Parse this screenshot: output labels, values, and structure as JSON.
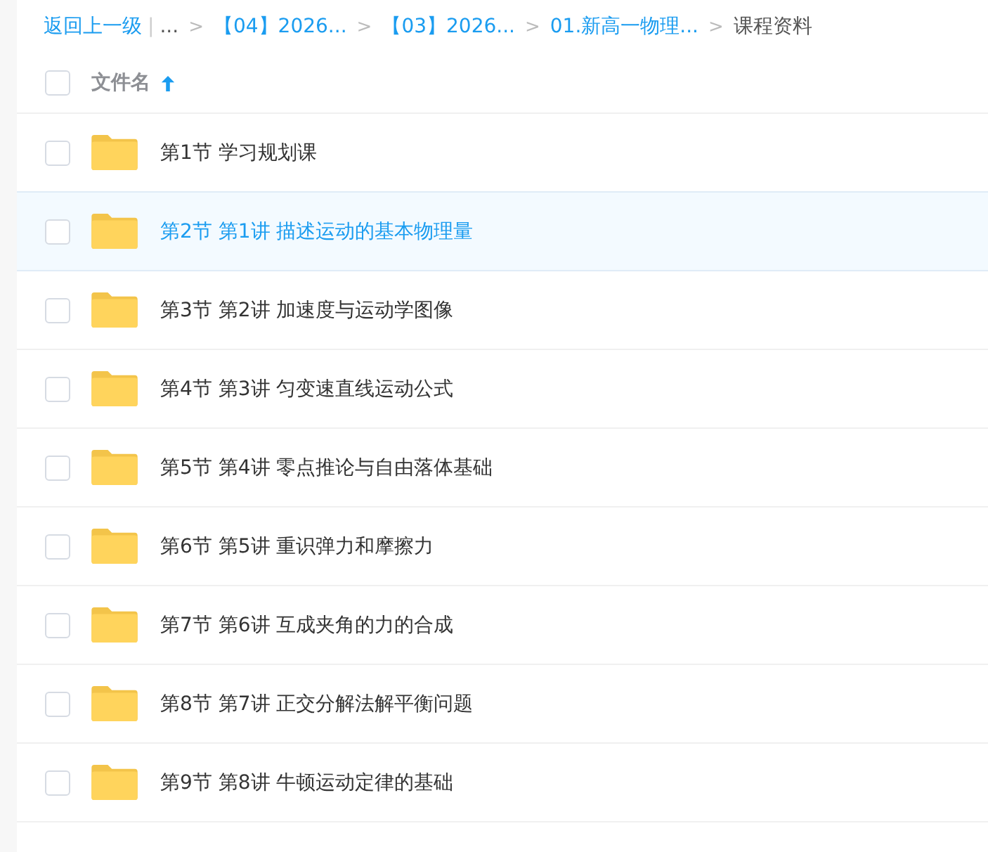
{
  "breadcrumb": {
    "back": "返回上一级",
    "separator": "|",
    "items": [
      {
        "label": "...",
        "link": false
      },
      {
        "label": "【04】2026...",
        "link": true
      },
      {
        "label": "【03】2026...",
        "link": true
      },
      {
        "label": "01.新高一物理...",
        "link": true
      },
      {
        "label": "课程资料",
        "link": false
      }
    ],
    "arrow": ">"
  },
  "header": {
    "checked": false,
    "column": "文件名",
    "sort_ascending": true
  },
  "rows": [
    {
      "name": "第1节 学习规划课",
      "checked": false,
      "highlighted": false
    },
    {
      "name": "第2节 第1讲 描述运动的基本物理量",
      "checked": false,
      "highlighted": true
    },
    {
      "name": "第3节 第2讲 加速度与运动学图像",
      "checked": false,
      "highlighted": false
    },
    {
      "name": "第4节 第3讲 匀变速直线运动公式",
      "checked": false,
      "highlighted": false
    },
    {
      "name": "第5节 第4讲 零点推论与自由落体基础",
      "checked": false,
      "highlighted": false
    },
    {
      "name": "第6节 第5讲 重识弹力和摩擦力",
      "checked": false,
      "highlighted": false
    },
    {
      "name": "第7节 第6讲 互成夹角的力的合成",
      "checked": false,
      "highlighted": false
    },
    {
      "name": "第8节 第7讲 正交分解法解平衡问题",
      "checked": false,
      "highlighted": false
    },
    {
      "name": "第9节 第8讲 牛顿运动定律的基础",
      "checked": false,
      "highlighted": false
    }
  ]
}
